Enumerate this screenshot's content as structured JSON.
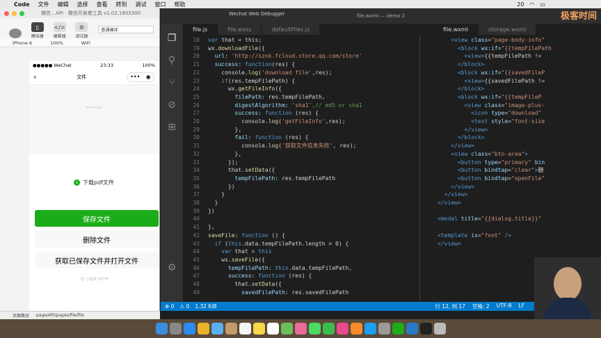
{
  "menubar": {
    "app": "Code",
    "items": [
      "文件",
      "编辑",
      "选择",
      "查看",
      "转到",
      "调试",
      "窗口",
      "帮助"
    ],
    "status": [
      "20",
      "Wi-Fi",
      "Battery"
    ]
  },
  "wx_devtools": {
    "title": "微信…API · 微信开发者工具 v1.02.1803300",
    "toolbar": [
      {
        "label": "模拟器",
        "icon": "simulator-icon"
      },
      {
        "label": "编辑器",
        "icon": "editor-icon"
      },
      {
        "label": "调试器",
        "icon": "debugger-icon"
      }
    ],
    "compile_mode": "普通编译",
    "device": "iPhone 6",
    "zoom": "100%",
    "network": "WiFi",
    "footer_path": "page/API/pages/file/file",
    "footer_label": "页面路径"
  },
  "phone": {
    "carrier": "●●●●● WeChat",
    "time": "23:33",
    "battery": "100%",
    "nav_title": "文件",
    "image_placeholder": "download",
    "download_label": "下载pdf文件",
    "buttons": [
      "保存文件",
      "删除文件",
      "获取已保存文件并打开文件"
    ],
    "bottom_hint": "\"在\"小程序\"中打开"
  },
  "vscode": {
    "window_title": "file.wxml — demo 2",
    "other_window": "Wechat Web Debugger",
    "tabs_left": [
      "file.js",
      "file.wxss",
      "defaultFiles.js"
    ],
    "tabs_right": [
      "file.wxml",
      "storage.wxml"
    ],
    "status": {
      "errors": "⊗ 0",
      "warnings": "⚠ 0",
      "size": "1.32 KiB",
      "position": "行 12, 列 17",
      "spaces": "空格: 2",
      "encoding": "UTF-8",
      "eol": "LF"
    }
  },
  "js_lines": [
    {
      "n": "18",
      "html": "<span class='kw'>var</span> <span class='pl'>that = this;</span>"
    },
    {
      "n": "19",
      "html": "<span class='pl'>wx.</span><span class='fn'>downloadFile</span><span class='pl'>({</span>"
    },
    {
      "n": "20",
      "html": "  <span class='pr'>url</span><span class='pl'>: </span><span class='str'>'http://sznk.fcloud.store.qq.com/store'</span>"
    },
    {
      "n": "21",
      "html": "  <span class='pr'>success</span><span class='pl'>: </span><span class='kw'>function</span><span class='pl'>(res) {</span>"
    },
    {
      "n": "22",
      "html": "    <span class='pl'>console.</span><span class='fn'>log</span><span class='pl'>(</span><span class='str'>'download file'</span><span class='pl'>,res);</span>"
    },
    {
      "n": "23",
      "html": "    <span class='kw'>if</span><span class='pl'>(res.tempFilePath) {</span>"
    },
    {
      "n": "24",
      "html": "      <span class='pl'>wx.</span><span class='fn'>getFileInfo</span><span class='pl'>({</span>"
    },
    {
      "n": "25",
      "html": "        <span class='pr'>filePath</span><span class='pl'>: res.tempFilePath,</span>"
    },
    {
      "n": "26",
      "html": "        <span class='pr'>digestAlgorithm</span><span class='pl'>: </span><span class='str'>'sha1'</span><span class='cm'>,// md5 or sha1</span>"
    },
    {
      "n": "27",
      "html": "        <span class='pr'>success</span><span class='pl'>: </span><span class='kw'>function</span><span class='pl'> (res) {</span>"
    },
    {
      "n": "28",
      "html": "          <span class='pl'>console.</span><span class='fn'>log</span><span class='pl'>(</span><span class='str'>'getFileInfo'</span><span class='pl'>,res);</span>"
    },
    {
      "n": "29",
      "html": "        <span class='pl'>},</span>"
    },
    {
      "n": "30",
      "html": "        <span class='pr'>fail</span><span class='pl'>: </span><span class='kw'>function</span><span class='pl'> (res) {</span>"
    },
    {
      "n": "31",
      "html": "          <span class='pl'>console.</span><span class='fn'>log</span><span class='pl'>(</span><span class='str'>'获取文件信息失败'</span><span class='pl'>, res);</span>"
    },
    {
      "n": "32",
      "html": "        <span class='pl'>},</span>"
    },
    {
      "n": "33",
      "html": "      <span class='pl'>});</span>"
    },
    {
      "n": "34",
      "html": "      <span class='pl'>that.</span><span class='fn'>setData</span><span class='pl'>({</span>"
    },
    {
      "n": "35",
      "html": "        <span class='pr'>tempFilePath</span><span class='pl'>: res.tempFilePath</span>"
    },
    {
      "n": "36",
      "html": "      <span class='pl'>})</span>"
    },
    {
      "n": "37",
      "html": "    <span class='pl'>}</span>"
    },
    {
      "n": "38",
      "html": "  <span class='pl'>}</span>"
    },
    {
      "n": "39",
      "html": "<span class='pl'>})</span>"
    },
    {
      "n": "40",
      "html": ""
    },
    {
      "n": "41",
      "html": "<span class='pl'>},</span>"
    },
    {
      "n": "42",
      "html": "<span class='fn'>saveFile</span><span class='pl'>: </span><span class='kw'>function</span><span class='pl'> () {</span>"
    },
    {
      "n": "43",
      "html": "  <span class='kw'>if</span><span class='pl'> (</span><span class='kw'>this</span><span class='pl'>.data.tempFilePath.length &gt; 0) {</span>"
    },
    {
      "n": "44",
      "html": "    <span class='kw'>var</span><span class='pl'> that = </span><span class='kw'>this</span>"
    },
    {
      "n": "45",
      "html": "    <span class='pl'>wx.</span><span class='fn'>saveFile</span><span class='pl'>({</span>"
    },
    {
      "n": "46",
      "html": "      <span class='pr'>tempFilePath</span><span class='pl'>: </span><span class='kw'>this</span><span class='pl'>.data.tempFilePath,</span>"
    },
    {
      "n": "47",
      "html": "      <span class='pr'>success</span><span class='pl'>: </span><span class='kw'>function</span><span class='pl'> (res) {</span>"
    },
    {
      "n": "48",
      "html": "        <span class='pl'>that.</span><span class='fn'>setData</span><span class='pl'>({</span>"
    },
    {
      "n": "49",
      "html": "          <span class='pr'>savedFilePath</span><span class='pl'>: res.savedFilePath</span>"
    }
  ],
  "wxml_lines": [
    {
      "html": "    <span class='tg'>&lt;view</span> <span class='at'>class</span><span class='pl'>=</span><span class='av'>\"page-body-info\"</span>"
    },
    {
      "html": "      <span class='tg'>&lt;block</span> <span class='at'>wx:if</span><span class='pl'>=</span><span class='av'>\"{{tempFilePath</span>"
    },
    {
      "html": "        <span class='tg'>&lt;view&gt;</span><span class='pl'>{{tempFilePath !=</span>"
    },
    {
      "html": "      <span class='tg'>&lt;/block&gt;</span>"
    },
    {
      "html": "      <span class='tg'>&lt;block</span> <span class='at'>wx:if</span><span class='pl'>=</span><span class='av'>\"{{savedFileP</span>"
    },
    {
      "html": "        <span class='tg'>&lt;view&gt;</span><span class='pl'>{{savedFilePath !=</span>"
    },
    {
      "html": "      <span class='tg'>&lt;/block&gt;</span>"
    },
    {
      "html": "      <span class='tg'>&lt;block</span> <span class='at'>wx:if</span><span class='pl'>=</span><span class='av'>\"{{tempFileP</span>"
    },
    {
      "html": "        <span class='tg'>&lt;view</span> <span class='at'>class</span><span class='pl'>=</span><span class='av'>\"image-plus-</span>"
    },
    {
      "html": "          <span class='tg'>&lt;icon</span> <span class='at'>type</span><span class='pl'>=</span><span class='av'>\"download\"</span>"
    },
    {
      "html": "          <span class='tg'>&lt;text</span> <span class='at'>style</span><span class='pl'>=</span><span class='av'>\"font-size</span>"
    },
    {
      "html": "        <span class='tg'>&lt;/view&gt;</span>"
    },
    {
      "html": "      <span class='tg'>&lt;/block&gt;</span>"
    },
    {
      "html": "    <span class='tg'>&lt;/view&gt;</span>"
    },
    {
      "html": "    <span class='tg'>&lt;view</span> <span class='at'>class</span><span class='pl'>=</span><span class='av'>\"btn-area\"</span><span class='tg'>&gt;</span>"
    },
    {
      "html": "      <span class='tg'>&lt;button</span> <span class='at'>type</span><span class='pl'>=</span><span class='av'>\"primary\"</span> <span class='at'>bin</span>"
    },
    {
      "html": "      <span class='tg'>&lt;button</span> <span class='at'>bindtap</span><span class='pl'>=</span><span class='av'>\"clear\"</span><span class='tg'>&gt;</span><span class='pl'>删</span>"
    },
    {
      "html": "      <span class='tg'>&lt;button</span> <span class='at'>bindtap</span><span class='pl'>=</span><span class='av'>\"openFile\"</span>"
    },
    {
      "html": "    <span class='tg'>&lt;/view&gt;</span>"
    },
    {
      "html": "  <span class='tg'>&lt;/view&gt;</span>"
    },
    {
      "html": "<span class='tg'>&lt;/view&gt;</span>"
    },
    {
      "html": ""
    },
    {
      "html": "<span class='tg'>&lt;modal</span> <span class='at'>title</span><span class='pl'>=</span><span class='av'>\"{{dialog.title}}\"</span>"
    },
    {
      "html": ""
    },
    {
      "html": "<span class='tg'>&lt;template</span> <span class='at'>is</span><span class='pl'>=</span><span class='av'>\"foot\"</span> <span class='tg'>/&gt;</span>"
    },
    {
      "html": "<span class='tg'>&lt;/view&gt;</span>"
    }
  ],
  "dock": [
    {
      "name": "finder-icon",
      "color": "#3b8de0"
    },
    {
      "name": "launchpad-icon",
      "color": "#888"
    },
    {
      "name": "safari-icon",
      "color": "#2a8cf0"
    },
    {
      "name": "chrome-icon",
      "color": "#e8b32a"
    },
    {
      "name": "mail-icon",
      "color": "#5ab0f0"
    },
    {
      "name": "contacts-icon",
      "color": "#c49a6c"
    },
    {
      "name": "calendar-icon",
      "color": "#f4f4f4"
    },
    {
      "name": "notes-icon",
      "color": "#f7d74a"
    },
    {
      "name": "reminders-icon",
      "color": "#fff"
    },
    {
      "name": "maps-icon",
      "color": "#6bbf59"
    },
    {
      "name": "photos-icon",
      "color": "#e86b9a"
    },
    {
      "name": "messages-icon",
      "color": "#4cd964"
    },
    {
      "name": "facetime-icon",
      "color": "#3dbb4e"
    },
    {
      "name": "itunes-icon",
      "color": "#e84a8c"
    },
    {
      "name": "ibooks-icon",
      "color": "#f58b2a"
    },
    {
      "name": "appstore-icon",
      "color": "#1c9ef2"
    },
    {
      "name": "settings-icon",
      "color": "#999"
    },
    {
      "name": "wechat-icon",
      "color": "#1aad19"
    },
    {
      "name": "vscode-icon",
      "color": "#2a7ac4"
    },
    {
      "name": "terminal-icon",
      "color": "#222"
    },
    {
      "name": "trash-icon",
      "color": "#bbb"
    }
  ],
  "brand_logo": "极客时间"
}
